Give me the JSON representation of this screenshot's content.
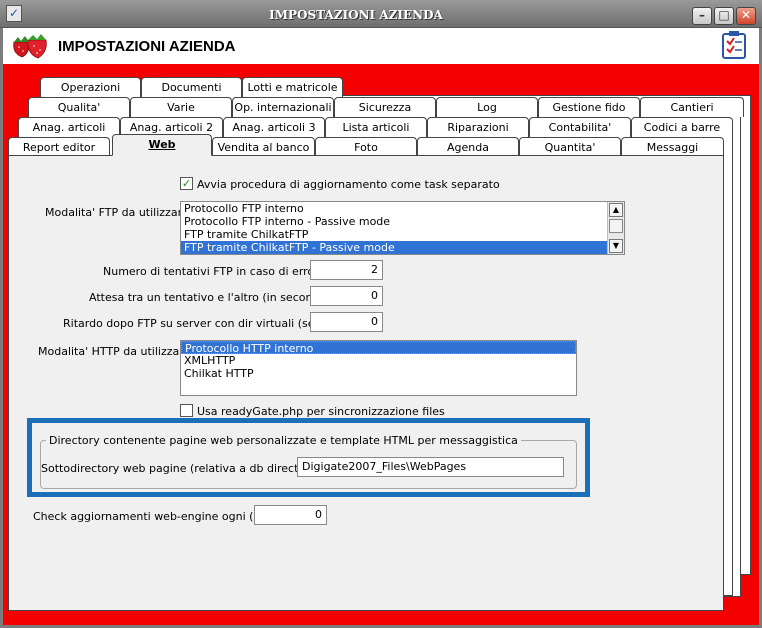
{
  "window": {
    "title": "IMPOSTAZIONI AZIENDA"
  },
  "header": {
    "title": "IMPOSTAZIONI AZIENDA"
  },
  "tabs": {
    "row1": [
      "Operazioni",
      "Documenti",
      "Lotti e matricole"
    ],
    "row2": [
      "Qualita'",
      "Varie",
      "Op. internazionali",
      "Sicurezza",
      "Log",
      "Gestione fido",
      "Cantieri"
    ],
    "row3": [
      "Anag. articoli",
      "Anag. articoli 2",
      "Anag. articoli 3",
      "Lista articoli",
      "Riparazioni",
      "Contabilita'",
      "Codici a barre"
    ],
    "row4": [
      "Report editor",
      "Web",
      "Vendita al banco",
      "Foto",
      "Agenda",
      "Quantita'",
      "Messaggi"
    ]
  },
  "form": {
    "task_checkbox": {
      "label": "Avvia procedura di aggiornamento come task separato",
      "checked": true
    },
    "ftp_mode": {
      "label": "Modalita' FTP da utilizzare :",
      "options": [
        "Protocollo FTP interno",
        "Protocollo FTP interno - Passive mode",
        "FTP tramite ChilkatFTP",
        "FTP tramite ChilkatFTP - Passive mode"
      ],
      "selected": "FTP tramite ChilkatFTP - Passive mode"
    },
    "ftp_attempts": {
      "label": "Numero di tentativi FTP in caso di errore :",
      "value": "2"
    },
    "attempt_wait": {
      "label": "Attesa tra un tentativo e l'altro (in secondi) :",
      "value": "0"
    },
    "ftp_delay": {
      "label": "Ritardo dopo FTP su server con dir virtuali (sec.) :",
      "value": "0"
    },
    "http_mode": {
      "label": "Modalita' HTTP da utilizzare :",
      "options": [
        "Protocollo HTTP interno",
        "XMLHTTP",
        "Chilkat HTTP"
      ],
      "selected": "Protocollo HTTP interno"
    },
    "readygate_checkbox": {
      "label": "Usa readyGate.php per sincronizzazione files",
      "checked": false
    },
    "web_dir_group": {
      "title": "Directory contenente pagine web personalizzate e template HTML per messaggistica",
      "subdir_label": "Sottodirectory web pagine (relativa a db directory) :",
      "subdir_value": "Digigate2007_Files\\WebPages"
    },
    "engine_check": {
      "label": "Check aggiornamenti web-engine ogni (ore) :",
      "value": "0"
    }
  },
  "colors": {
    "accent_red": "#f50000",
    "highlight_blue": "#1b6fb8",
    "selection_blue": "#3173d4"
  }
}
